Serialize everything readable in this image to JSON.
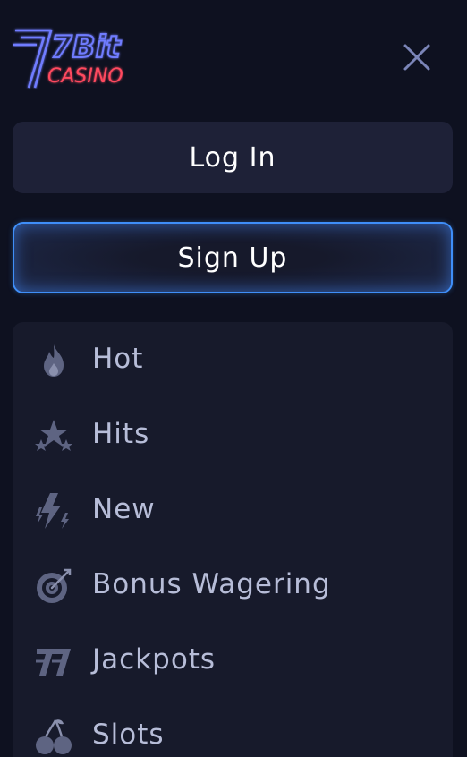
{
  "header": {
    "logo_text_top": "7Bit",
    "logo_text_bottom": "CASINO",
    "close_icon": "close-icon"
  },
  "auth": {
    "login_label": "Log In",
    "signup_label": "Sign Up"
  },
  "menu": {
    "items": [
      {
        "label": "Hot",
        "icon": "flame-icon"
      },
      {
        "label": "Hits",
        "icon": "stars-icon"
      },
      {
        "label": "New",
        "icon": "lightning-icon"
      },
      {
        "label": "Bonus Wagering",
        "icon": "target-icon"
      },
      {
        "label": "Jackpots",
        "icon": "sevens-icon"
      },
      {
        "label": "Slots",
        "icon": "cherries-icon"
      }
    ]
  },
  "colors": {
    "background": "#0e1120",
    "button_bg": "#1e2137",
    "signup_border": "#3f8ef8",
    "menu_bg": "#171a2b",
    "menu_text": "#b7bdd8",
    "icon_color": "#5e6482",
    "logo_blue": "#6f7cff",
    "logo_red": "#ff4a5e"
  }
}
